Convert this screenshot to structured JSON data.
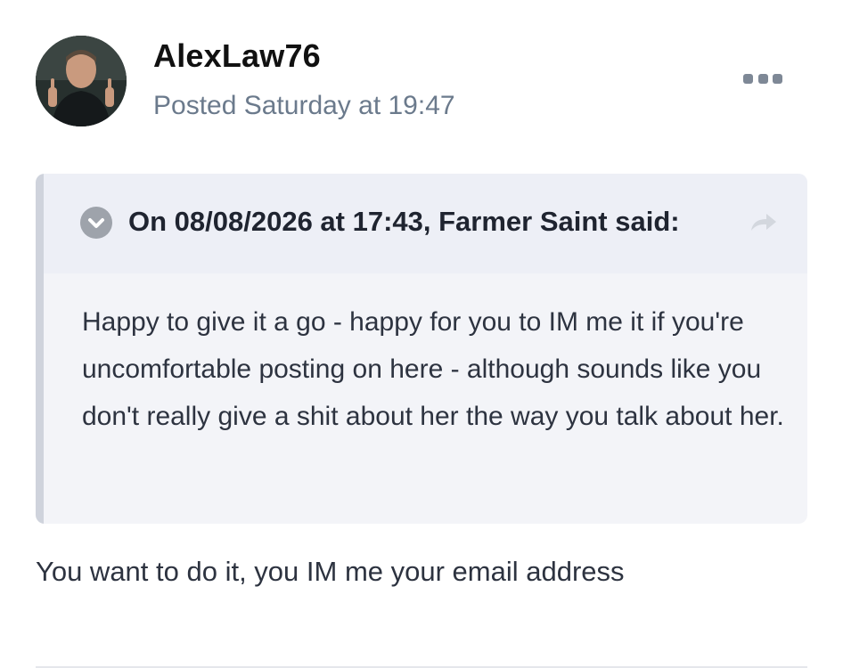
{
  "post": {
    "author": "AlexLaw76",
    "meta": "Posted Saturday at 19:47",
    "avatar_icon": "avatar-photo",
    "menu_icon": "more-options-icon"
  },
  "quote": {
    "citation": "On 08/08/2026 at 17:43, Farmer Saint said:",
    "collapse_icon": "chevron-down-circle-icon",
    "share_icon": "share-arrow-icon",
    "text": "Happy to give it a go - happy for you to IM me it if you're uncomfortable posting on here - although sounds like you don't really give a shit about her the way you talk about her."
  },
  "reply": {
    "text": "You want to do it, you IM me your email address"
  },
  "colors": {
    "author": "#111111",
    "meta": "#6b7a8c",
    "quote_background": "#f3f4f8",
    "quote_header_background": "#edeff6",
    "quote_bar": "#cfd3dc",
    "body_text": "#2d3340"
  }
}
